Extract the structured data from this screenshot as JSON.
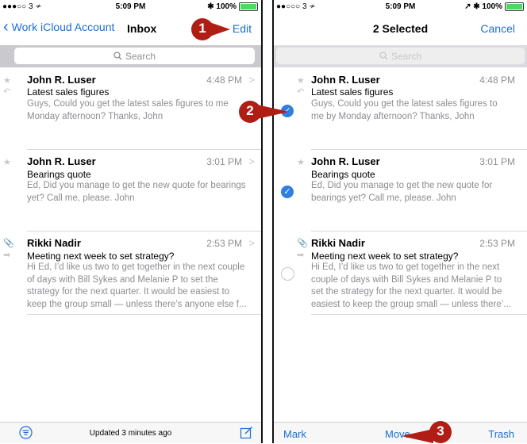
{
  "left": {
    "status": {
      "carrier": "●●●○○ 3 ≁",
      "time": "5:09 PM",
      "battery": "✱ 100%"
    },
    "nav": {
      "back_label": "Work iCloud Account",
      "title": "Inbox",
      "edit_label": "Edit"
    },
    "search": {
      "placeholder": "Search"
    },
    "messages": [
      {
        "sender": "John R. Luser",
        "time": "4:48 PM",
        "subject": "Latest sales figures",
        "preview1": "Guys, Could you get the latest sales figures to me",
        "preview2": "Monday afternoon? Thanks, John"
      },
      {
        "sender": "John R. Luser",
        "time": "3:01 PM",
        "subject": "Bearings quote",
        "preview1": "Ed, Did you manage to get the new quote for bearings",
        "preview2": "yet? Call me, please. John"
      },
      {
        "sender": "Rikki Nadir",
        "time": "2:53 PM",
        "subject": "Meeting next week to set strategy?",
        "preview1": "Hi Ed, I’d like us two to get together in the next couple",
        "preview2": "of days with Bill Sykes and Melanie P to set the",
        "preview3": "strategy for the next quarter. It would be easiest to",
        "preview4": "keep the group small — unless there’s anyone else f..."
      }
    ],
    "toolbar": {
      "updated": "Updated 3 minutes ago"
    }
  },
  "right": {
    "status": {
      "carrier": "●●○○○ 3 ≁",
      "time": "5:09 PM",
      "battery": "↗ ✱ 100%"
    },
    "nav": {
      "title": "2 Selected",
      "cancel_label": "Cancel"
    },
    "search": {
      "placeholder": "Search"
    },
    "messages": [
      {
        "sender": "John R. Luser",
        "time": "4:48 PM",
        "subject": "Latest sales figures",
        "preview1": "Guys, Could you get the latest sales figures to",
        "preview2": "me by Monday afternoon? Thanks, John",
        "selected": true
      },
      {
        "sender": "John R. Luser",
        "time": "3:01 PM",
        "subject": "Bearings quote",
        "preview1": "Ed, Did you manage to get the new quote for",
        "preview2": "bearings yet? Call me, please. John",
        "selected": true
      },
      {
        "sender": "Rikki Nadir",
        "time": "2:53 PM",
        "subject": "Meeting next week to set strategy?",
        "preview1": "Hi Ed, I’d like us two to get together in the next",
        "preview2": "couple of days with Bill Sykes and Melanie P to",
        "preview3": "set the strategy for the next quarter. It would be",
        "preview4": "easiest to keep the group small — unless there’...",
        "selected": false
      }
    ],
    "toolbar": {
      "mark_label": "Mark",
      "move_label": "Move",
      "trash_label": "Trash"
    }
  },
  "callouts": {
    "step1": "1",
    "step2": "2",
    "step3": "3"
  },
  "colors": {
    "accent": "#1a6fd6",
    "callout": "#b01d14",
    "selected_check": "#2f7ee0"
  }
}
